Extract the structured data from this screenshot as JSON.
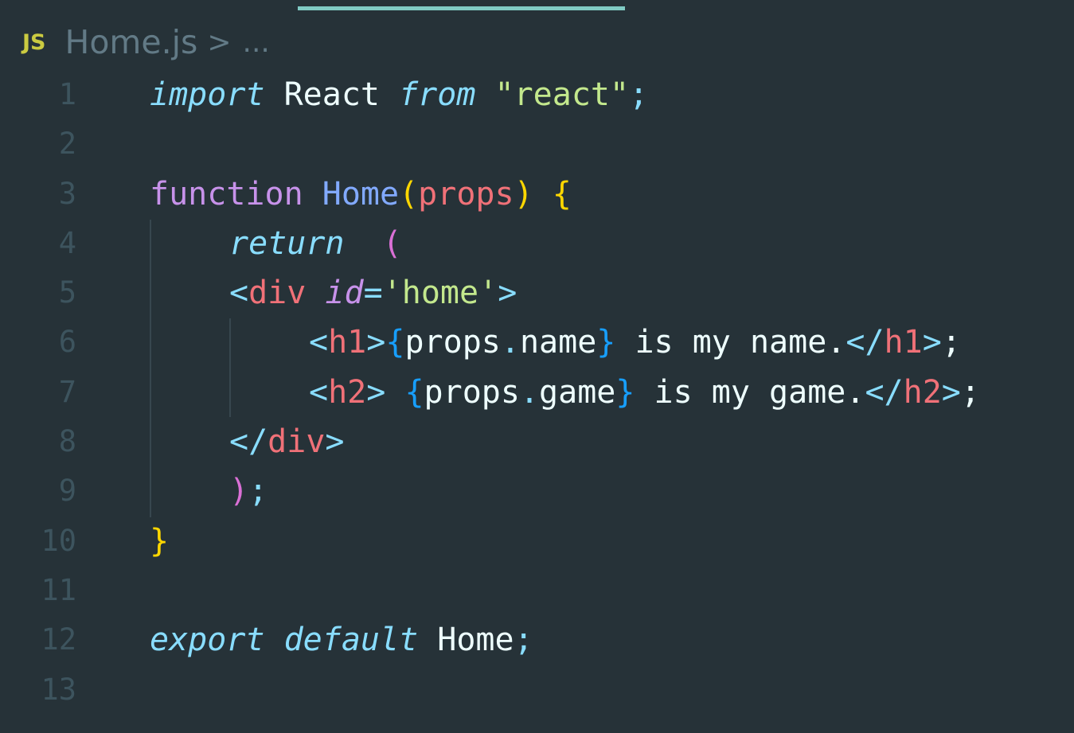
{
  "breadcrumb": {
    "file_icon": "JS",
    "file_name": "Home.js",
    "chevron": ">",
    "ellipsis": "..."
  },
  "line_numbers": [
    "1",
    "2",
    "3",
    "4",
    "5",
    "6",
    "7",
    "8",
    "9",
    "10",
    "11",
    "12",
    "13"
  ],
  "code": {
    "l1": {
      "kw1": "import",
      "id": " React ",
      "kw2": "from",
      "str": " \"react\"",
      "semi": ";"
    },
    "l3": {
      "kw": "function",
      "name": " Home",
      "lp": "(",
      "param": "props",
      "rp": ")",
      "brace": " {"
    },
    "l4": {
      "kw": "return",
      "paren": "  ("
    },
    "l5": {
      "open": "<",
      "tag": "div",
      "attr": " id",
      "eq": "=",
      "str": "'home'",
      "close": ">"
    },
    "l6": {
      "open": "<",
      "tag": "h1",
      "close": ">",
      "lb": "{",
      "obj": "props",
      "dot": ".",
      "prop": "name",
      "rb": "}",
      "text": " is my name.",
      "eopen": "</",
      "etag": "h1",
      "eclose": ">",
      "semi": ";"
    },
    "l7": {
      "open": "<",
      "tag": "h2",
      "close": ">",
      "lb": " {",
      "obj": "props",
      "dot": ".",
      "prop": "game",
      "rb": "}",
      "text": " is my game.",
      "eopen": "</",
      "etag": "h2",
      "eclose": ">",
      "semi": ";"
    },
    "l8": {
      "open": "</",
      "tag": "div",
      "close": ">"
    },
    "l9": {
      "paren": ")",
      "semi": ";"
    },
    "l10": {
      "brace": "}"
    },
    "l12": {
      "kw1": "export",
      "kw2": " default",
      "id": " Home",
      "semi": ";"
    }
  },
  "colors": {
    "background": "#263238",
    "tab_indicator": "#80cbc4",
    "line_number": "#3d545e",
    "js_icon": "#cbcb41"
  }
}
